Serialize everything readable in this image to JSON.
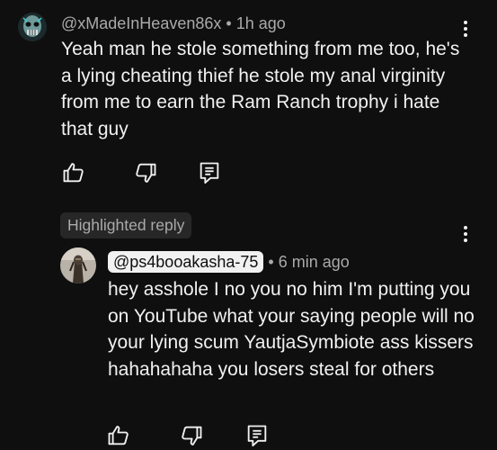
{
  "comment": {
    "author": "@xMadeInHeaven86x",
    "separator": "•",
    "time": "1h ago",
    "text": "Yeah man he stole something from me too, he's a lying cheating thief he stole my anal virginity from me to earn the Ram Ranch trophy i hate that guy",
    "actions": [
      "like-icon",
      "dislike-icon",
      "reply-icon"
    ]
  },
  "highlighted_label": "Highlighted reply",
  "reply": {
    "author": "@ps4booakasha-75",
    "separator": "•",
    "time": "6 min ago",
    "text": "hey asshole I no you no him I'm putting you on YouTube what your saying people will no your lying scum  YautjaSymbiote ass kissers hahahahaha you losers steal for others",
    "actions": [
      "like-icon",
      "dislike-icon",
      "reply-icon"
    ]
  },
  "colors": {
    "background": "#0f0f0f",
    "text": "#f1f1f1",
    "secondary_text": "#aaaaaa",
    "chip_background": "#272727"
  }
}
